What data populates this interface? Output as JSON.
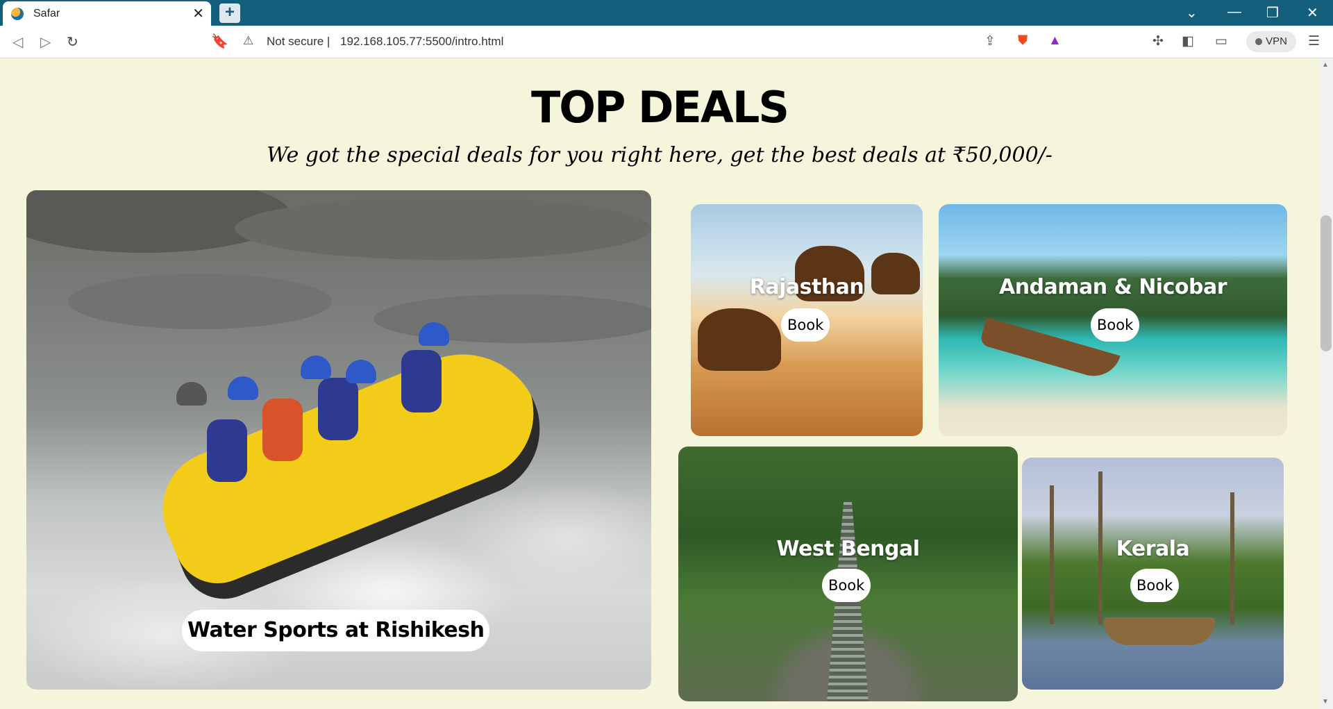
{
  "browser": {
    "tab_title": "Safar",
    "tab_close": "✕",
    "new_tab": "+",
    "win_minimize": "—",
    "win_restore": "❐",
    "win_close": "✕",
    "win_dropdown": "⌄",
    "nav_back": "◁",
    "nav_forward": "▷",
    "nav_reload": "↻",
    "bookmark": "🔖",
    "security_warning_icon": "⚠",
    "security_text": "Not secure  |",
    "url": "192.168.105.77:5500/intro.html",
    "vpn_label": "VPN"
  },
  "page": {
    "heading": "TOP DEALS",
    "subheading": "We got the special deals for you right here, get the best deals at ₹50,000/-",
    "featured": {
      "label": "Water Sports at Rishikesh"
    },
    "deals": [
      {
        "name": "Rajasthan",
        "book": "Book"
      },
      {
        "name": "Andaman & Nicobar",
        "book": "Book"
      },
      {
        "name": "West Bengal",
        "book": "Book"
      },
      {
        "name": "Kerala",
        "book": "Book"
      }
    ]
  },
  "colors": {
    "tabbar": "#135f7c",
    "page_bg": "#f5f5dc"
  }
}
